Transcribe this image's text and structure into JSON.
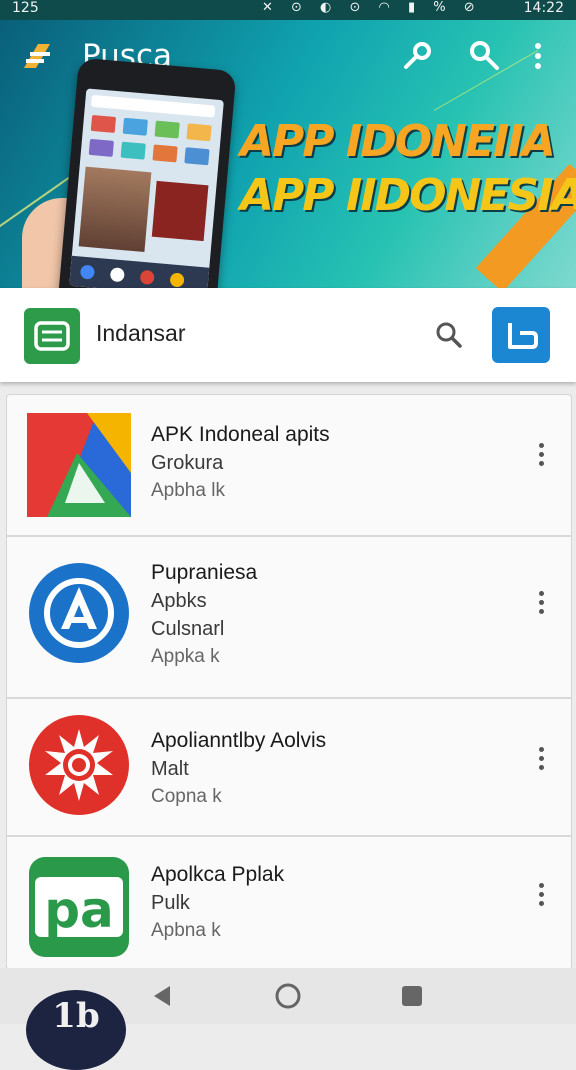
{
  "status_bar": {
    "carrier": "125",
    "time": "14:22",
    "icons": "✕ ⊙ ◐ ⊙ ◠ ▮ % ⊘"
  },
  "header": {
    "title": "Pusca",
    "brand_icon": "stylized-f-logo",
    "actions": [
      "key-icon",
      "search-icon",
      "overflow-menu-icon"
    ]
  },
  "banner": {
    "headline_1": "APP IDONEIIA",
    "headline_2": "APP IIDONESIA"
  },
  "search": {
    "value": "Indansar",
    "left_icon": "green-list-app-icon",
    "right_button_icon": "blue-tag-icon"
  },
  "apps": [
    {
      "title": "APK Indoneal apits",
      "lines": [
        "Grokura"
      ],
      "meta": "Apbha lk",
      "icon": "colorful-triangle-logo"
    },
    {
      "title": "Pupraniesa",
      "lines": [
        "Apbks",
        "Culsnarl"
      ],
      "meta": "Appka k",
      "icon": "blue-circle-a-logo"
    },
    {
      "title": "Apolianntlby Aolvis",
      "lines": [
        "Malt"
      ],
      "meta": "Copna k",
      "icon": "red-sun-logo"
    },
    {
      "title": "Apolkca Pplak",
      "lines": [
        "Pulk"
      ],
      "meta": "Apbna k",
      "icon": "green-pa-logo"
    }
  ],
  "nav": {
    "items": [
      "back-icon",
      "home-icon",
      "recents-icon"
    ]
  },
  "corner_badge": {
    "text": "1b"
  },
  "colors": {
    "accent_blue": "#1b86d2",
    "accent_green": "#2e9b4b",
    "banner_teal": "#10a3b0",
    "headline_orange": "#f6a623"
  }
}
